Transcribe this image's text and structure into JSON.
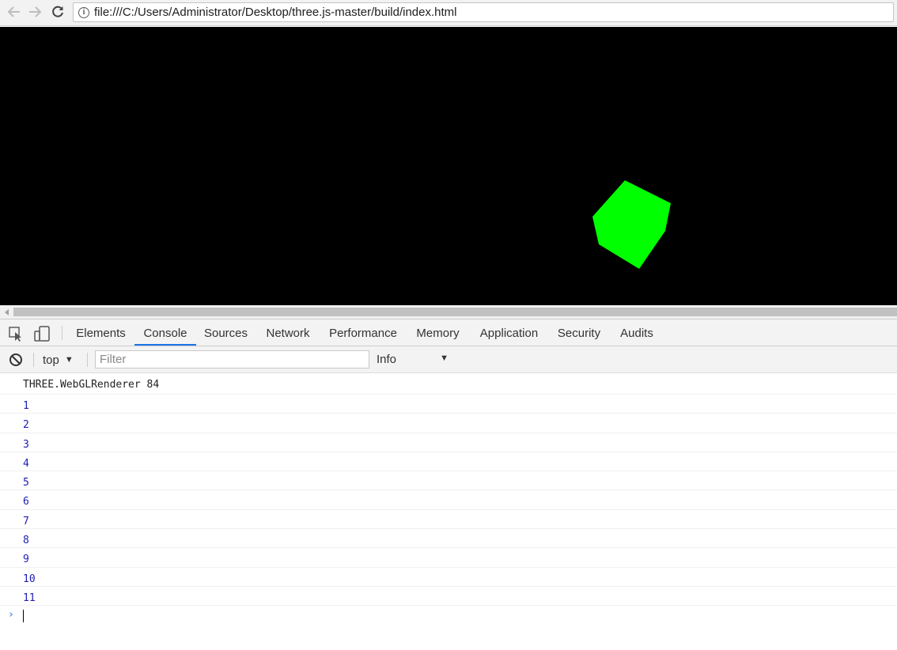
{
  "browser": {
    "url": "file:///C:/Users/Administrator/Desktop/three.js-master/build/index.html",
    "back_icon": "arrow-left-icon",
    "forward_icon": "arrow-right-icon",
    "reload_icon": "reload-icon",
    "info_icon": "info-icon",
    "info_glyph": "i"
  },
  "viewport": {
    "background": "#000000",
    "cube_color": "#00ff00"
  },
  "devtools": {
    "tabs": [
      {
        "label": "Elements"
      },
      {
        "label": "Console",
        "active": true
      },
      {
        "label": "Sources"
      },
      {
        "label": "Network"
      },
      {
        "label": "Performance"
      },
      {
        "label": "Memory"
      },
      {
        "label": "Application"
      },
      {
        "label": "Security"
      },
      {
        "label": "Audits"
      }
    ],
    "accent": "#1a73e8"
  },
  "console": {
    "context": "top",
    "filter_placeholder": "Filter",
    "level": "Info",
    "messages": [
      {
        "text": "THREE.WebGLRenderer 84",
        "kind": "log"
      },
      {
        "text": "1",
        "kind": "number"
      },
      {
        "text": "2",
        "kind": "number"
      },
      {
        "text": "3",
        "kind": "number"
      },
      {
        "text": "4",
        "kind": "number"
      },
      {
        "text": "5",
        "kind": "number"
      },
      {
        "text": "6",
        "kind": "number"
      },
      {
        "text": "7",
        "kind": "number"
      },
      {
        "text": "8",
        "kind": "number"
      },
      {
        "text": "9",
        "kind": "number"
      },
      {
        "text": "10",
        "kind": "number"
      },
      {
        "text": "11",
        "kind": "number"
      }
    ],
    "prompt_glyph": "›"
  }
}
